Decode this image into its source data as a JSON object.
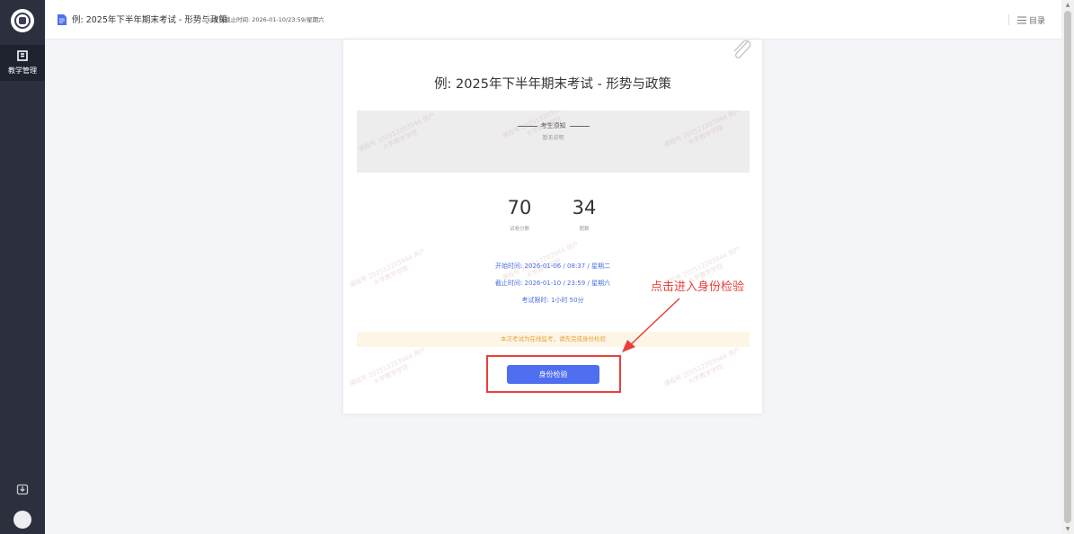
{
  "sidebar": {
    "nav_item_label": "教学管理",
    "nav_item_icon": "teaching-icon",
    "download_icon": "download-icon",
    "avatar_icon": "avatar"
  },
  "topbar": {
    "title": "例: 2025年下半年期末考试 - 形势与政策",
    "deadline": "考核截止时间: 2026-01-10/23:59/星期六",
    "toc_label": "目录",
    "toc_icon": "list-icon"
  },
  "card": {
    "title": "例: 2025年下半年期末考试 - 形势与政策",
    "notice_title": "考生须知",
    "notice_sub": "暂无说明",
    "score_value": "70",
    "score_label": "试卷分数",
    "count_value": "34",
    "count_label": "题数",
    "start_time": "开始时间: 2026-01-06 / 08:37 / 星期二",
    "end_time": "截止时间: 2026-01-10 / 23:59 / 星期六",
    "duration": "考试限时: 1小时 50分",
    "warning": "本次考试为在线监考，请先完成身份检验",
    "verify_button": "身份检验"
  },
  "watermark": {
    "line1": "课程号 202512203944 用户",
    "line2": "大学教学学院"
  },
  "annotation": {
    "text": "点击进入身份检验"
  },
  "colors": {
    "sidebar_bg": "#2b2f3e",
    "accent": "#4f6ef0",
    "link": "#4a6ee0",
    "warning": "#e6a23c",
    "annotation": "#e8413a"
  }
}
